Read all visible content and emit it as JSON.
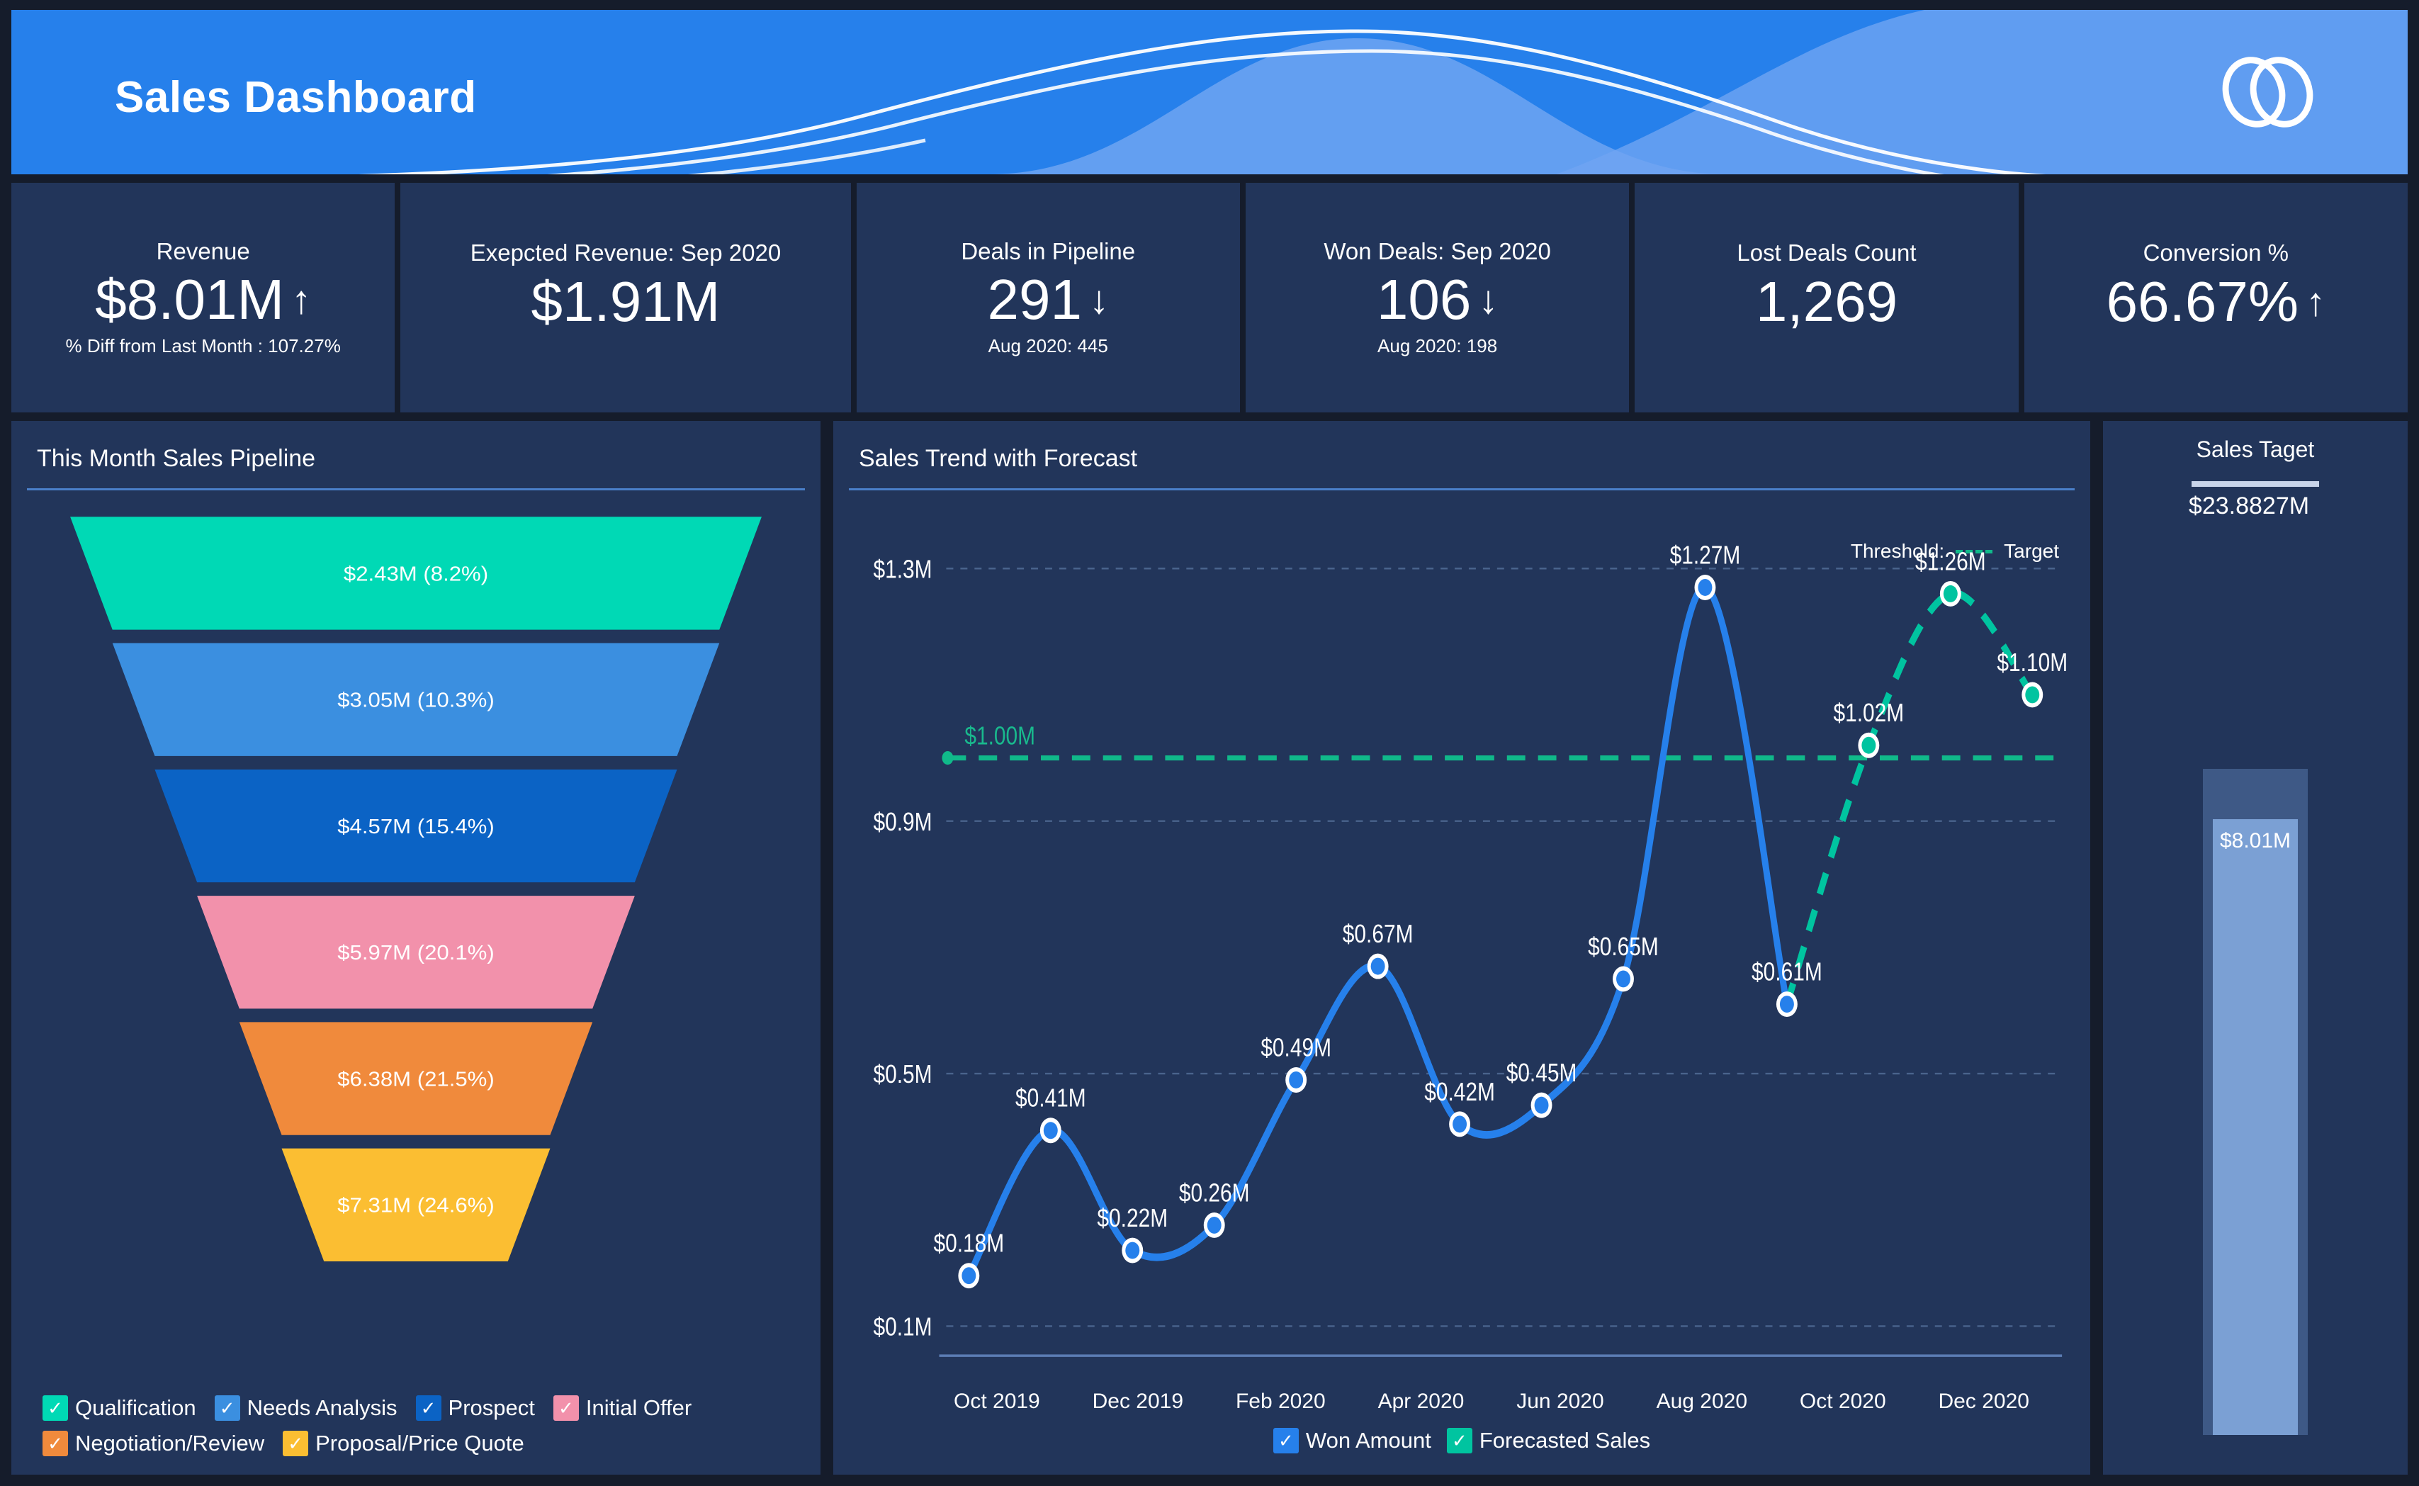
{
  "header": {
    "title": "Sales Dashboard",
    "logo_icon": "zoho-infinity-loops-icon",
    "bg_color": "#2680eb",
    "accent_color": "#6fa4f2"
  },
  "kpis": [
    {
      "label": "Revenue",
      "value": "$8.01M",
      "arrow": "↑",
      "sub": "% Diff from Last Month : 107.27%"
    },
    {
      "label": "Exepcted Revenue: Sep 2020",
      "value": "$1.91M",
      "arrow": "",
      "sub": ""
    },
    {
      "label": "Deals in Pipeline",
      "value": "291",
      "arrow": "↓",
      "sub": "Aug 2020: 445"
    },
    {
      "label": "Won Deals: Sep 2020",
      "value": "106",
      "arrow": "↓",
      "sub": "Aug 2020: 198"
    },
    {
      "label": "Lost Deals Count",
      "value": "1,269",
      "arrow": "",
      "sub": ""
    },
    {
      "label": "Conversion %",
      "value": "66.67%",
      "arrow": "↑",
      "sub": ""
    }
  ],
  "funnel_panel": {
    "title": "This Month Sales Pipeline",
    "legend": [
      {
        "label": "Qualification",
        "color": "#00d9b5",
        "checked": "✓"
      },
      {
        "label": "Needs Analysis",
        "color": "#3b8fe0",
        "checked": "✓"
      },
      {
        "label": "Prospect",
        "color": "#0b63c5",
        "checked": "✓"
      },
      {
        "label": "Initial Offer",
        "color": "#f291ab",
        "checked": "✓"
      },
      {
        "label": "Negotiation/Review",
        "color": "#f08a3c",
        "checked": "✓"
      },
      {
        "label": "Proposal/Price Quote",
        "color": "#fbbe32",
        "checked": "✓"
      }
    ]
  },
  "trend_panel": {
    "title": "Sales Trend with Forecast",
    "threshold_label": "Threshold:",
    "target_label": "Target",
    "legend": [
      {
        "label": "Won Amount",
        "color": "#2680eb",
        "checked": "✓"
      },
      {
        "label": "Forecasted Sales",
        "color": "#00c4a0",
        "checked": "✓"
      }
    ]
  },
  "target_panel": {
    "title": "Sales Taget",
    "target_value": "$23.8827M",
    "actual_value": "$8.01M"
  },
  "chart_data": [
    {
      "type": "funnel",
      "title": "This Month Sales Pipeline",
      "stages": [
        {
          "name": "Qualification",
          "amount": "$2.43M",
          "percent": "8.2%",
          "label": "$2.43M (8.2%)",
          "value": 2.43,
          "pct": 8.2,
          "color": "#00d9b5"
        },
        {
          "name": "Needs Analysis",
          "amount": "$3.05M",
          "percent": "10.3%",
          "label": "$3.05M (10.3%)",
          "value": 3.05,
          "pct": 10.3,
          "color": "#3b8fe0"
        },
        {
          "name": "Prospect",
          "amount": "$4.57M",
          "percent": "15.4%",
          "label": "$4.57M (15.4%)",
          "value": 4.57,
          "pct": 15.4,
          "color": "#0b63c5"
        },
        {
          "name": "Initial Offer",
          "amount": "$5.97M",
          "percent": "20.1%",
          "label": "$5.97M (20.1%)",
          "value": 5.97,
          "pct": 20.1,
          "color": "#f291ab"
        },
        {
          "name": "Negotiation/Review",
          "amount": "$6.38M",
          "percent": "21.5%",
          "label": "$6.38M (21.5%)",
          "value": 6.38,
          "pct": 21.5,
          "color": "#f08a3c"
        },
        {
          "name": "Proposal/Price Quote",
          "amount": "$7.31M",
          "percent": "24.6%",
          "label": "$7.31M (24.6%)",
          "value": 7.31,
          "pct": 24.6,
          "color": "#fbbe32"
        }
      ]
    },
    {
      "type": "line",
      "title": "Sales Trend with Forecast",
      "xlabel": "",
      "ylabel": "",
      "ylim": [
        0.1,
        1.3
      ],
      "ytick_labels": [
        "$1.3M",
        "$0.9M",
        "$0.5M",
        "$0.1M"
      ],
      "ytick_values": [
        1.3,
        0.9,
        0.5,
        0.1
      ],
      "xtick_labels": [
        "Oct 2019",
        "Dec 2019",
        "Feb 2020",
        "Apr 2020",
        "Jun 2020",
        "Aug 2020",
        "Oct 2020",
        "Dec 2020"
      ],
      "grid": true,
      "legend_position": "bottom",
      "threshold": {
        "value": 1.0,
        "label": "$1.00M",
        "color": "#10b98a",
        "style": "dashed",
        "legend": "Target"
      },
      "series": [
        {
          "name": "Won Amount",
          "color": "#2680eb",
          "style": "solid",
          "x": [
            "Oct 2019",
            "Nov 2019",
            "Dec 2019",
            "Jan 2020",
            "Feb 2020",
            "Mar 2020",
            "Apr 2020",
            "May 2020",
            "Jun 2020",
            "Jul 2020",
            "Aug 2020",
            "Sep 2020"
          ],
          "values": [
            0.18,
            0.41,
            0.22,
            0.26,
            0.49,
            0.67,
            0.42,
            0.45,
            0.65,
            1.27,
            0.61
          ],
          "point_labels": [
            "$0.18M",
            "$0.41M",
            "$0.22M",
            "$0.26M",
            "$0.49M",
            "$0.67M",
            "$0.42M",
            "$0.45M",
            "$0.65M",
            "$1.27M",
            "$0.61M"
          ]
        },
        {
          "name": "Forecasted Sales",
          "color": "#00c4a0",
          "style": "dashed",
          "x": [
            "Oct 2020",
            "Nov 2020",
            "Dec 2020"
          ],
          "values": [
            1.02,
            1.26,
            1.1
          ],
          "point_labels": [
            "$1.02M",
            "$1.26M",
            "$1.10M"
          ]
        }
      ]
    },
    {
      "type": "bar",
      "title": "Sales Taget",
      "categories": [
        "Sales Target"
      ],
      "values": [
        8.01
      ],
      "target": 23.8827,
      "value_label": "$8.01M",
      "target_label": "$23.8827M",
      "ylabel": "",
      "bar_color": "#7ba0d4",
      "track_color": "#3e5986"
    }
  ]
}
